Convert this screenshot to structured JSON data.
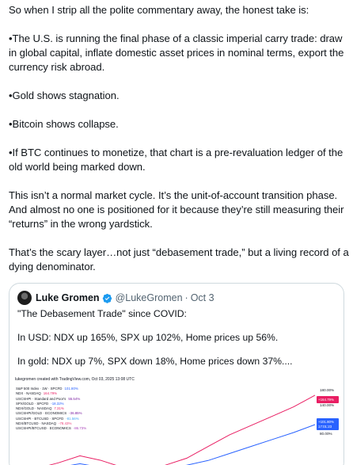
{
  "post": {
    "paragraphs": [
      "So when I strip all the polite commentary away, the honest take is:",
      "•The U.S. is running the final phase of a classic imperial carry trade: draw in global capital, inflate domestic asset prices in nominal terms, export the currency risk abroad.",
      "•Gold shows stagnation.",
      "•Bitcoin shows collapse.",
      "•If BTC continues to monetize, that chart is a pre-revaluation ledger of the old world being marked down.",
      "This isn’t a normal market cycle. It’s the unit-of-account transition phase. And almost no one is positioned for it because they’re still measuring their “returns” in the wrong yardstick.",
      "That’s the scary layer…not just “debasement trade,” but a living record of a dying denominator."
    ]
  },
  "quote": {
    "author_name": "Luke Gromen",
    "verified_icon": "verified-badge-icon",
    "handle": "@LukeGromen",
    "separator": "·",
    "date": "Oct 3",
    "paragraphs": [
      "\"The Debasement Trade\" since COVID:",
      "In USD: NDX up 165%, SPX up 102%, Home prices up 56%.",
      "In gold: NDX up 7%, SPX down 18%, Home prices down 37%...."
    ]
  },
  "chart_data": {
    "type": "line",
    "credit": "lukegromen created with TradingView.com, Oct 03, 2025 13:08 UTC",
    "legend": [
      {
        "name": "S&P 500 Index · 1W · SPCFD",
        "value": "101.80%",
        "color": "#2962ff"
      },
      {
        "name": "NDX · NASDAQ",
        "value": "164.79%",
        "color": "#e91e63"
      },
      {
        "name": "USCSHPI · Standard and Poor's",
        "value": "55.54%",
        "color": "#7b1fa2"
      },
      {
        "name": "SPX/GOLD · SPCFD",
        "value": "-18.32%",
        "color": "#2962ff"
      },
      {
        "name": "NDX/GOLD · NASDAQ",
        "value": "7.31%",
        "color": "#e91e63"
      },
      {
        "name": "USCSHPI/GOLD · ECONOMICS",
        "value": "-36.85%",
        "color": "#7b1fa2"
      },
      {
        "name": "USCSHPI · BTCUSD · SPCFD",
        "value": "-81.56%",
        "color": "#42a5f5"
      },
      {
        "name": "NDX/BTCUSD · NASDAQ",
        "value": "-78.43%",
        "color": "#ec407a"
      },
      {
        "name": "USCSHPI/BTCUSD · ECONOMICS",
        "value": "-86.73%",
        "color": "#ab47bc"
      }
    ],
    "y_ticks": [
      "180.00%",
      "140.00%",
      "120.00%",
      "80.00%"
    ],
    "badges": [
      {
        "text": "+164.79%",
        "color": "#e91e63"
      },
      {
        "text": "+101.80%",
        "color": "#2962ff"
      },
      {
        "text": "17:01:23",
        "color": "#2962ff"
      }
    ],
    "series": [
      {
        "name": "NDX",
        "color": "#e91e63",
        "values": [
          0,
          8,
          20,
          35,
          25,
          10,
          5,
          15,
          30,
          55,
          80,
          100,
          120,
          140,
          165
        ]
      },
      {
        "name": "S&P 500",
        "color": "#2962ff",
        "values": [
          0,
          5,
          10,
          18,
          10,
          5,
          2,
          8,
          15,
          25,
          40,
          55,
          70,
          85,
          102
        ]
      }
    ]
  }
}
